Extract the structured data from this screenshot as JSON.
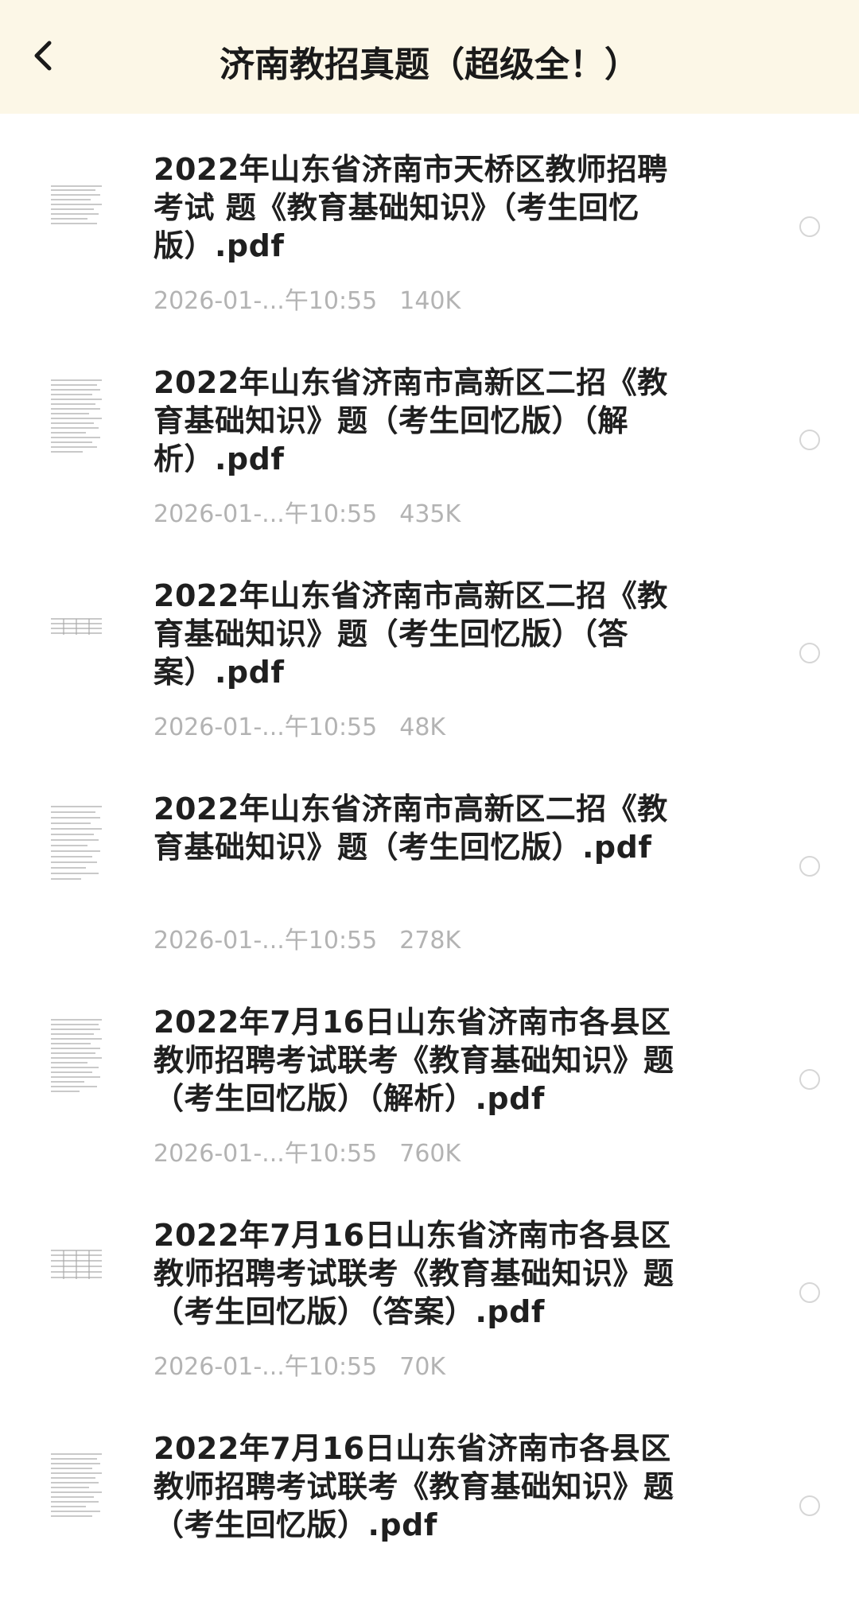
{
  "header": {
    "back_icon": "chevron-left-icon",
    "title": "济南教招真题（超级全！）",
    "background": "#fcf7e7"
  },
  "files": [
    {
      "name": "2022年山东省济南市天桥区教师招聘考试 题《教育基础知识》（考生回忆版）.pdf",
      "date": "2026-01-...午10:55",
      "size": "140K"
    },
    {
      "name": "2022年山东省济南市高新区二招《教育基础知识》题（考生回忆版）（解析）.pdf",
      "date": "2026-01-...午10:55",
      "size": "435K"
    },
    {
      "name": "2022年山东省济南市高新区二招《教育基础知识》题（考生回忆版）（答案）.pdf",
      "date": "2026-01-...午10:55",
      "size": "48K"
    },
    {
      "name": "2022年山东省济南市高新区二招《教育基础知识》题（考生回忆版）.pdf",
      "date": "2026-01-...午10:55",
      "size": "278K"
    },
    {
      "name": "2022年7月16日山东省济南市各县区教师招聘考试联考《教育基础知识》题（考生回忆版）（解析）.pdf",
      "date": "2026-01-...午10:55",
      "size": "760K"
    },
    {
      "name": "2022年7月16日山东省济南市各县区教师招聘考试联考《教育基础知识》题（考生回忆版）（答案）.pdf",
      "date": "2026-01-...午10:55",
      "size": "70K"
    },
    {
      "name": "2022年7月16日山东省济南市各县区教师招聘考试联考《教育基础知识》题（考生回忆版）.pdf",
      "date": "",
      "size": ""
    }
  ]
}
